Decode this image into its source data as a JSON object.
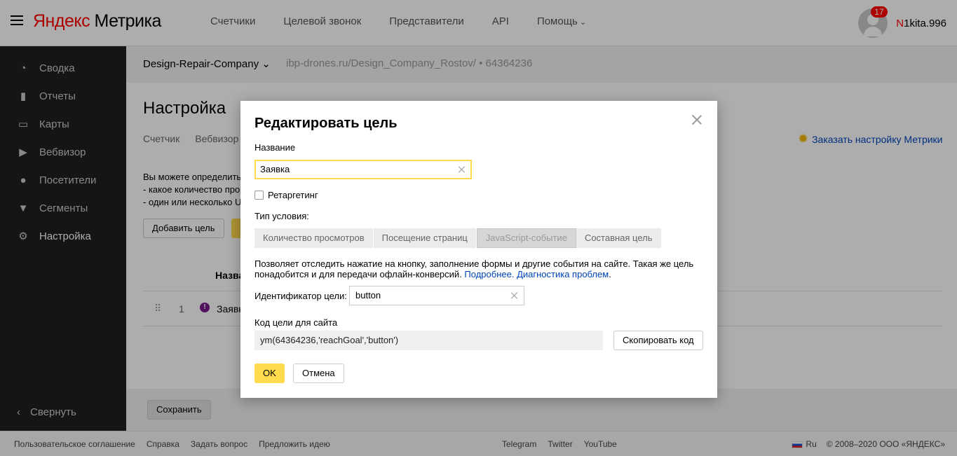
{
  "header": {
    "logo_ya": "Яндекс",
    "logo_rest": " Метрика",
    "nav": [
      "Счетчики",
      "Целевой звонок",
      "Представители",
      "API",
      "Помощь"
    ],
    "notification_count": "17",
    "username_first": "N",
    "username_rest": "1kita.996"
  },
  "sidebar": {
    "items": [
      {
        "label": "Сводка",
        "icon": "dashboard-icon"
      },
      {
        "label": "Отчеты",
        "icon": "bar-chart-icon"
      },
      {
        "label": "Карты",
        "icon": "map-icon"
      },
      {
        "label": "Вебвизор",
        "icon": "play-icon"
      },
      {
        "label": "Посетители",
        "icon": "person-icon"
      },
      {
        "label": "Сегменты",
        "icon": "filter-icon"
      },
      {
        "label": "Настройка",
        "icon": "gear-icon"
      }
    ],
    "collapse_label": "Свернуть"
  },
  "subheader": {
    "counter_name": "Design-Repair-Company",
    "counter_url": "ibp-drones.ru/Design_Company_Rostov/ • 64364236"
  },
  "page": {
    "title": "Настройка",
    "tabs": [
      "Счетчик",
      "Вебвизор"
    ],
    "order_link": "Заказать настройку Метрики",
    "desc_line1": "Вы можете определить",
    "desc_line2": "-  какое количество про",
    "desc_line3": "-  один или несколько U",
    "add_goal": "Добавить цель",
    "table_header": "Назва",
    "row_num": "1",
    "row_name": "Заявк",
    "save": "Сохранить"
  },
  "modal": {
    "title": "Редактировать цель",
    "name_label": "Название",
    "name_value": "Заявка",
    "retargeting_label": "Ретаргетинг",
    "condition_label": "Тип условия:",
    "condition_options": [
      "Количество просмотров",
      "Посещение страниц",
      "JavaScript-событие",
      "Составная цель"
    ],
    "selected_condition": "JavaScript-событие",
    "help_text_1": "Позволяет отследить нажатие на кнопку, заполнение формы и другие события на сайте. Такая же цель понадобится и для передачи офлайн-конверсий. ",
    "help_link_more": "Подробнее.",
    "help_link_diag": "Диагностика проблем",
    "help_end": ".",
    "id_label": "Идентификатор цели:",
    "id_value": "button",
    "code_label": "Код цели для сайта",
    "code_value": "ym(64364236,'reachGoal','button')",
    "copy_button": "Скопировать код",
    "ok_button": "OK",
    "cancel_button": "Отмена"
  },
  "footer": {
    "left_links": [
      "Пользовательское соглашение",
      "Справка",
      "Задать вопрос",
      "Предложить идею"
    ],
    "social_links": [
      "Telegram",
      "Twitter",
      "YouTube"
    ],
    "lang": "Ru",
    "copyright": "© 2008–2020 ООО «ЯНДЕКС»"
  },
  "colors": {
    "accent_yellow": "#ffdb4d",
    "link_blue": "#0044bb",
    "sidebar_bg": "#1f1f1f",
    "logo_red": "#ff0000"
  }
}
